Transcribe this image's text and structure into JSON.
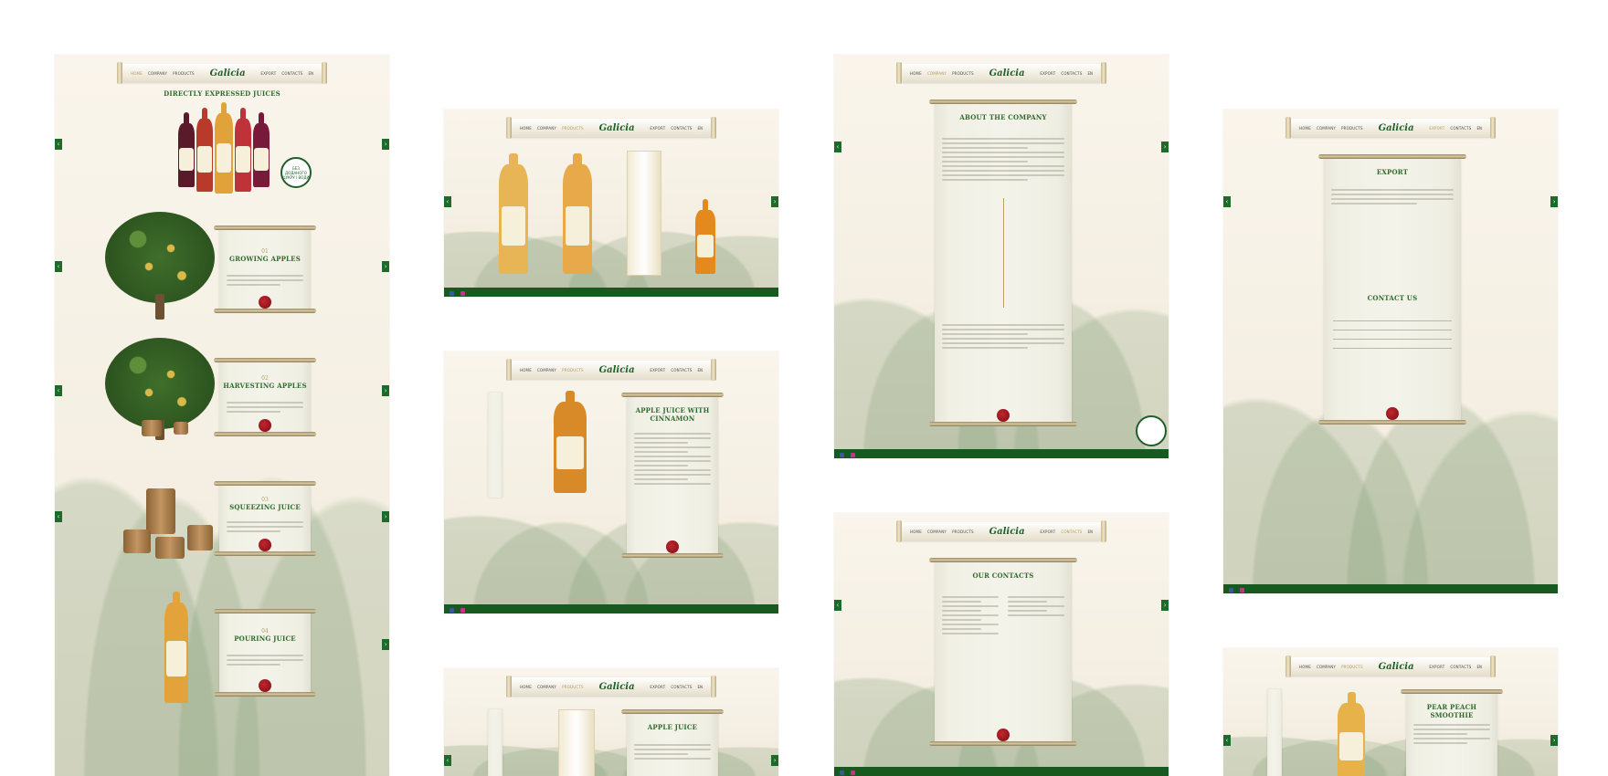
{
  "nav": {
    "logo": "Galicia",
    "links_left": [
      "HOME",
      "COMPANY",
      "PRODUCTS"
    ],
    "links_right": [
      "EXPORT",
      "CONTACTS"
    ],
    "lang": "EN"
  },
  "mock1": {
    "hero_title": "DIRECTLY EXPRESSED JUICES",
    "badge_text": "БЕЗ ДОДАНОГО ЦУКРУ І ВОДИ",
    "sections": [
      {
        "num": "01",
        "title": "GROWING APPLES"
      },
      {
        "num": "02",
        "title": "HARVESTING APPLES"
      },
      {
        "num": "03",
        "title": "SQUEEZING JUICE"
      },
      {
        "num": "04",
        "title": "POURING JUICE"
      }
    ]
  },
  "mock3": {
    "product_title": "APPLE JUICE WITH CINNAMON"
  },
  "mock4": {
    "product_title": "APPLE JUICE"
  },
  "mock5": {
    "title": "ABOUT THE COMPANY"
  },
  "mock6": {
    "title": "OUR CONTACTS"
  },
  "mock7": {
    "title": "EXPORT",
    "contact_title": "CONTACT US"
  },
  "mock8": {
    "product_title": "PEAR PEACH SMOOTHIE"
  },
  "colors": {
    "brand_green": "#1f5f2a",
    "footer_green": "#17591f",
    "accent_gold": "#b8a264",
    "seal_red": "#a01b22"
  }
}
